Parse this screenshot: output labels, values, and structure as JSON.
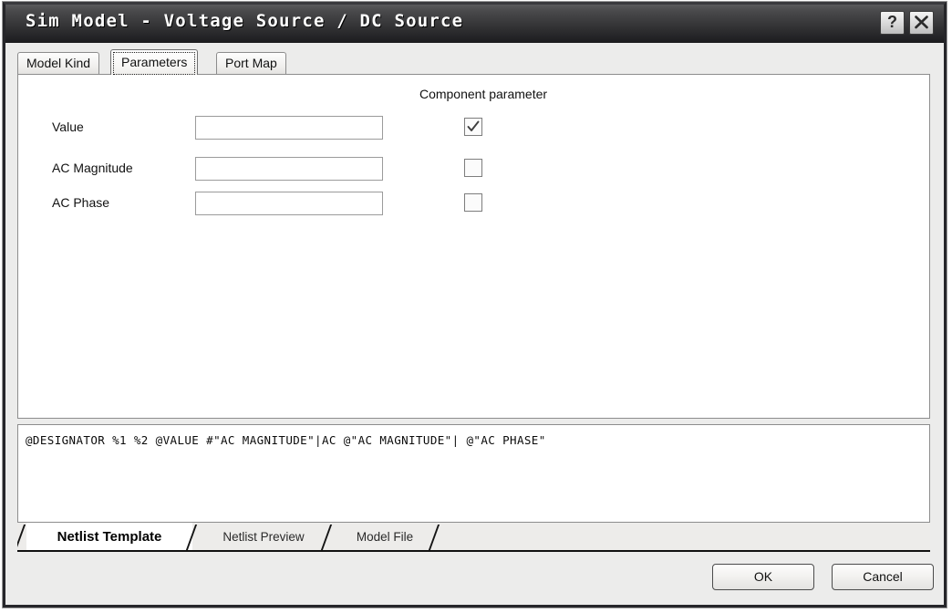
{
  "window": {
    "title": "Sim Model - Voltage Source / DC Source",
    "help_button": "?",
    "close_button": "close-icon"
  },
  "top_tabs": [
    {
      "label": "Model Kind",
      "active": false
    },
    {
      "label": "Parameters",
      "active": true
    },
    {
      "label": "Port Map",
      "active": false
    }
  ],
  "panel": {
    "component_parameter_header": "Component parameter",
    "rows": [
      {
        "label": "Value",
        "value": "",
        "placeholder": "",
        "checked": true
      },
      {
        "label": "AC Magnitude",
        "value": "",
        "placeholder": "",
        "checked": false
      },
      {
        "label": "AC Phase",
        "value": "",
        "placeholder": "",
        "checked": false
      }
    ]
  },
  "netlist": {
    "text": "@DESIGNATOR %1 %2 @VALUE #\"AC MAGNITUDE\"|AC @\"AC MAGNITUDE\"| @\"AC PHASE\""
  },
  "bottom_tabs": [
    {
      "label": "Netlist Template",
      "active": true
    },
    {
      "label": "Netlist Preview",
      "active": false
    },
    {
      "label": "Model File",
      "active": false
    }
  ],
  "footer": {
    "ok_label": "OK",
    "cancel_label": "Cancel"
  },
  "colors": {
    "titlebar": "#3a3a3c",
    "window_bg": "#ececeb",
    "panel_bg": "#ffffff",
    "border": "#8d8d8d"
  }
}
